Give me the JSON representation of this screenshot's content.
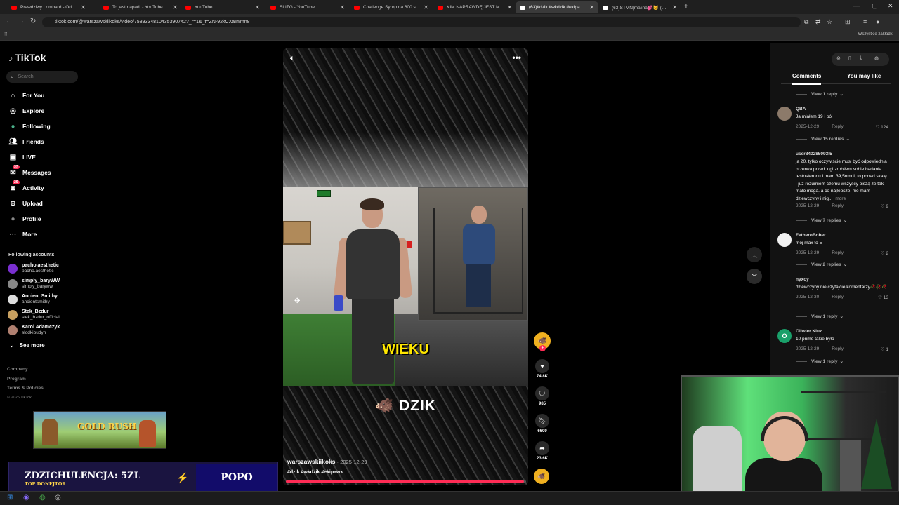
{
  "browser": {
    "tabs": [
      {
        "title": "Prawdziwy Lombard - Odcinek",
        "favicon_color": "#ff0000",
        "active": false
      },
      {
        "title": "To jest napad! - YouTube",
        "favicon_color": "#ff0000",
        "active": false
      },
      {
        "title": "YouTube",
        "favicon_color": "#ff0000",
        "active": false
      },
      {
        "title": "ŚLIZG - YouTube",
        "favicon_color": "#ff0000",
        "active": false
      },
      {
        "title": "Challenge Syrop na 600 sub - Y",
        "favicon_color": "#ff0000",
        "active": false
      },
      {
        "title": "KIM NAPRAWDĘ JEST MAKALI",
        "favicon_color": "#ff0000",
        "active": false
      },
      {
        "title": "(63)#dzik #wkdzik #ekipawk | T",
        "favicon_color": "#ffffff",
        "active": true
      },
      {
        "title": "(63)STMN|malina💕🐱 (@role",
        "favicon_color": "#ffffff",
        "active": false
      }
    ],
    "url": "tiktok.com/@warszawskiikoks/video/7589334810435390742?_r=1&_t=ZN-92kCXaImmn8",
    "bookmarks_all": "Wszystkie zakładki"
  },
  "sidebar": {
    "logo": "TikTok",
    "search_placeholder": "Search",
    "menu": [
      {
        "label": "For You",
        "icon": "home-icon"
      },
      {
        "label": "Explore",
        "icon": "compass-icon"
      },
      {
        "label": "Following",
        "icon": "following-avatar-icon"
      },
      {
        "label": "Friends",
        "icon": "friends-icon"
      },
      {
        "label": "LIVE",
        "icon": "live-icon"
      },
      {
        "label": "Messages",
        "icon": "messages-icon",
        "badge": "37"
      },
      {
        "label": "Activity",
        "icon": "activity-icon",
        "badge": "26"
      },
      {
        "label": "Upload",
        "icon": "upload-icon"
      },
      {
        "label": "Profile",
        "icon": "profile-avatar-icon"
      },
      {
        "label": "More",
        "icon": "more-icon"
      }
    ],
    "following_title": "Following accounts",
    "following": [
      {
        "name": "pacho.aesthetic",
        "handle": "pacho.aesthetic",
        "color": "#7a2fd0"
      },
      {
        "name": "simply_baryWW",
        "handle": "simply_baryww",
        "color": "#888888"
      },
      {
        "name": "Ancient Smithy",
        "handle": "ancientsmithy",
        "color": "#dddddd"
      },
      {
        "name": "Stek_Bzdur",
        "handle": "stek_bzdur_official",
        "color": "#c8a060"
      },
      {
        "name": "Karol Adamczyk",
        "handle": "slodkibudyn",
        "color": "#b08070"
      }
    ],
    "see_more": "See more",
    "footer": [
      "Company",
      "Program",
      "Terms & Policies",
      "© 2026 TikTok"
    ]
  },
  "overlays": {
    "banner_title": "GOLD RUSH",
    "donate_label": "ZDZICHULENCJA: 5ZL",
    "donate_sub": "TOP DONEJTOR",
    "donate_name": "POPO"
  },
  "video": {
    "caption": "WIEKU",
    "watermark": "DZIK",
    "author": "warszawskiikoks",
    "date": "2025-12-29",
    "tags": "#dzik #wkdzik #ekipawk",
    "progress": 0.99,
    "actions": [
      {
        "name": "like",
        "icon": "heart-icon",
        "count": "74.8K"
      },
      {
        "name": "comment",
        "icon": "comment-icon",
        "count": "985"
      },
      {
        "name": "save",
        "icon": "bookmark-icon",
        "count": "6609"
      },
      {
        "name": "share",
        "icon": "share-icon",
        "count": "23.6K"
      }
    ]
  },
  "comments_panel": {
    "tabs": [
      "Comments",
      "You may like"
    ],
    "items": [
      {
        "kind": "view",
        "text": "View 1 reply"
      },
      {
        "kind": "comment",
        "user": "QBA",
        "text": "Ja miałem 19 i pół",
        "date": "2025-12-29",
        "reply": "Reply",
        "likes": "124",
        "avatar_color": "#8c7a6a"
      },
      {
        "kind": "view",
        "text": "View 15 replies"
      },
      {
        "kind": "comment",
        "user": "user840285093l5",
        "text": "ja 20, tylko oczywiście musi być odpowiednia przerwa przed. ogl zrobiłem sobie badania testosteronu i mam 39,5nmol, to ponad skalę. i już rozumiem czemu wszyscy piszą że tak mało mogą. a co najlepsze, nie mam dziewczyny i nig...",
        "more": "more",
        "date": "2025-12-29",
        "reply": "Reply",
        "likes": "9",
        "avatar_color": "#121212"
      },
      {
        "kind": "view",
        "text": "View 7 replies"
      },
      {
        "kind": "comment",
        "user": "FetheroBober",
        "text": "mój max to 5",
        "date": "2025-12-29",
        "reply": "Reply",
        "likes": "2",
        "avatar_color": "#f2f2f2"
      },
      {
        "kind": "view",
        "text": "View 2 replies"
      },
      {
        "kind": "comment",
        "user": "nyxoy",
        "text": "dziewczyny nie czytajcie komentarzy🥀🥀🥀",
        "date": "2025-12-30",
        "reply": "Reply",
        "likes": "13",
        "avatar_color": "#121212"
      },
      {
        "kind": "view",
        "text": "View 1 reply"
      },
      {
        "kind": "comment",
        "user": "Oliwier Kluz",
        "text": "10 prime takie było",
        "date": "2025-12-29",
        "reply": "Reply",
        "likes": "1",
        "avatar_color": "#1aa06a",
        "initial": "O"
      },
      {
        "kind": "view",
        "text": "View 1 reply"
      }
    ]
  }
}
